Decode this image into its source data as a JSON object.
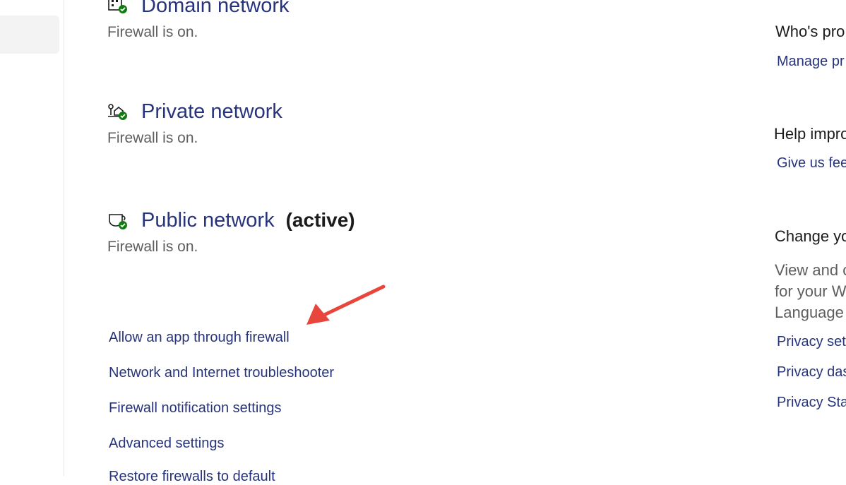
{
  "networks": [
    {
      "title": "Domain network",
      "status": "Firewall is on.",
      "icon": "domain-network-icon"
    },
    {
      "title": "Private network",
      "status": "Firewall is on.",
      "icon": "private-network-icon"
    },
    {
      "title": "Public network",
      "active_label": "(active)",
      "status": "Firewall is on.",
      "icon": "public-network-icon"
    }
  ],
  "links": [
    "Allow an app through firewall",
    "Network and Internet troubleshooter",
    "Firewall notification settings",
    "Advanced settings",
    "Restore firewalls to default"
  ],
  "sidebar": {
    "protect_heading": "Who's pro",
    "protect_link": "Manage pr",
    "improve_heading": "Help impro",
    "improve_link": "Give us fee",
    "privacy_heading": "Change yo",
    "privacy_text": [
      "View and c",
      "for your W",
      "Language"
    ],
    "privacy_links": [
      "Privacy set",
      "Privacy das",
      "Privacy Sta"
    ]
  },
  "colors": {
    "link": "#27347b",
    "status_ok": "#107c10",
    "annotation_arrow": "#e8453c"
  }
}
